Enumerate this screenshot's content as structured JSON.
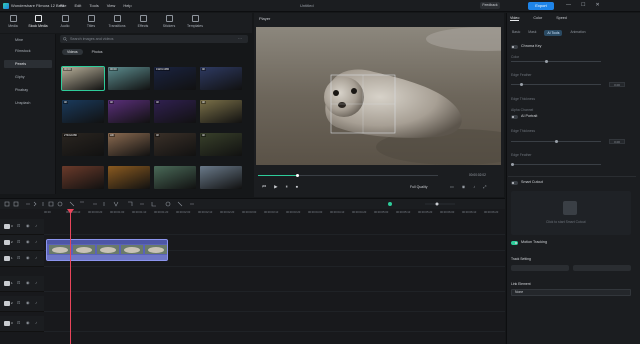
{
  "app": {
    "title": "Wondershare Filmora 12 Beta",
    "doc_title": "Untitled",
    "menu": [
      "File",
      "Edit",
      "Tools",
      "View",
      "Help"
    ],
    "feedback": "Feedback",
    "export": "Export",
    "win": [
      "—",
      "☐",
      "✕"
    ]
  },
  "library": {
    "tabs": [
      "Media",
      "Stock Media",
      "Audio",
      "Titles",
      "Transitions",
      "Effects",
      "Stickers",
      "Templates"
    ],
    "active_tab": "Stock Media",
    "sidebar": [
      "Mine",
      "Filmstock",
      "Pexels",
      "Giphy",
      "Pixabay",
      "Unsplash"
    ],
    "selected": "Pexels",
    "search_placeholder": "Search images and videos",
    "view_tabs": [
      "Videos",
      "Photos"
    ],
    "thumbs": [
      {
        "dur": "00:00:",
        "c": "#b8b09a"
      },
      {
        "dur": "00:00:",
        "c": "#5c8c8e"
      },
      {
        "dur": "1920×1080",
        "c": "#1a2340"
      },
      {
        "dur": "4K",
        "c": "#2e3a62"
      },
      {
        "dur": "4K",
        "c": "#1a3a5c"
      },
      {
        "dur": "4K",
        "c": "#5a2f7a"
      },
      {
        "dur": "4K",
        "c": "#302050"
      },
      {
        "dur": "4K",
        "c": "#7a7048"
      },
      {
        "dur": "2740x1080",
        "c": "#2a2520"
      },
      {
        "dur": "HD",
        "c": "#8a6a50"
      },
      {
        "dur": "4K",
        "c": "#3a3028"
      },
      {
        "dur": "4K",
        "c": "#38402a"
      },
      {
        "dur": "",
        "c": "#6a3a2a"
      },
      {
        "dur": "",
        "c": "#8a5a20"
      },
      {
        "dur": "",
        "c": "#4a6a58"
      },
      {
        "dur": "",
        "c": "#6a7a8a"
      }
    ]
  },
  "player": {
    "label": "Player",
    "timecode": "00:00:02:02",
    "quality": "Full Quality"
  },
  "panel": {
    "tabs": [
      "Video",
      "Color",
      "Speed"
    ],
    "subtabs": [
      "Basic",
      "Mask",
      "AI Tools",
      "Animation"
    ],
    "active_subtab": "AI Tools",
    "chroma_key": "Chroma Key",
    "chroma_rows": [
      "Color",
      "Edge Feather",
      "Edge Thickness",
      "Alpha Channel"
    ],
    "ai_portrait": "AI Portrait",
    "portrait_rows": [
      "Edge Thickness",
      "Edge Feather"
    ],
    "smart_cutout": "Smart Cutout",
    "cutout_hint": "Click to start Smart Cutout",
    "motion_tracking": "Motion Tracking",
    "track_setting": "Track Setting",
    "link_element": "Link Element",
    "link_value": "None",
    "values": {
      "edge_feather": "0.00",
      "edge_thickness": "0.00"
    }
  },
  "timeline": {
    "ticks": [
      "00:00",
      "00:00:00:10",
      "00:00:00:20",
      "00:00:01:00",
      "00:00:01:10",
      "00:00:01:20",
      "00:00:02:00",
      "00:00:02:10",
      "00:00:02:20",
      "00:00:03:00",
      "00:00:03:10",
      "00:00:03:20",
      "00:00:04:00",
      "00:00:04:10",
      "00:00:04:20",
      "00:00:05:00",
      "00:00:05:10",
      "00:00:05:20",
      "00:00:06:00",
      "00:00:06:10",
      "00:00:06:20"
    ],
    "tracks": [
      "3",
      "2",
      "1",
      "1",
      "2",
      "3"
    ]
  }
}
